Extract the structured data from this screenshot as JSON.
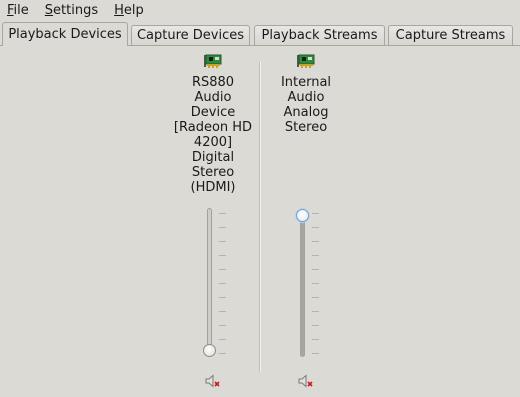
{
  "menubar": {
    "items": [
      {
        "mnemonic": "F",
        "rest": "ile"
      },
      {
        "mnemonic": "S",
        "rest": "ettings"
      },
      {
        "mnemonic": "H",
        "rest": "elp"
      }
    ]
  },
  "tabs": [
    {
      "label": "Playback Devices",
      "active": true
    },
    {
      "label": "Capture Devices",
      "active": false
    },
    {
      "label": "Playback Streams",
      "active": false
    },
    {
      "label": "Capture Streams",
      "active": false
    }
  ],
  "devices": [
    {
      "name_lines": [
        "RS880",
        "Audio",
        "Device",
        "[Radeon HD",
        "4200]",
        "Digital",
        "Stereo",
        "(HDMI)"
      ],
      "icon": "sound-card-icon",
      "volume_level": 0.0,
      "mute_icon": "speaker-muted-icon"
    },
    {
      "name_lines": [
        "Internal",
        "Audio",
        "Analog",
        "Stereo"
      ],
      "icon": "sound-card-icon",
      "volume_level": 1.0,
      "mute_icon": "speaker-muted-icon"
    }
  ],
  "colors": {
    "background": "#dcdad5",
    "card_green": "#2f8a3a",
    "mute_red": "#d01818",
    "focus_blue": "#6f9fd0"
  }
}
